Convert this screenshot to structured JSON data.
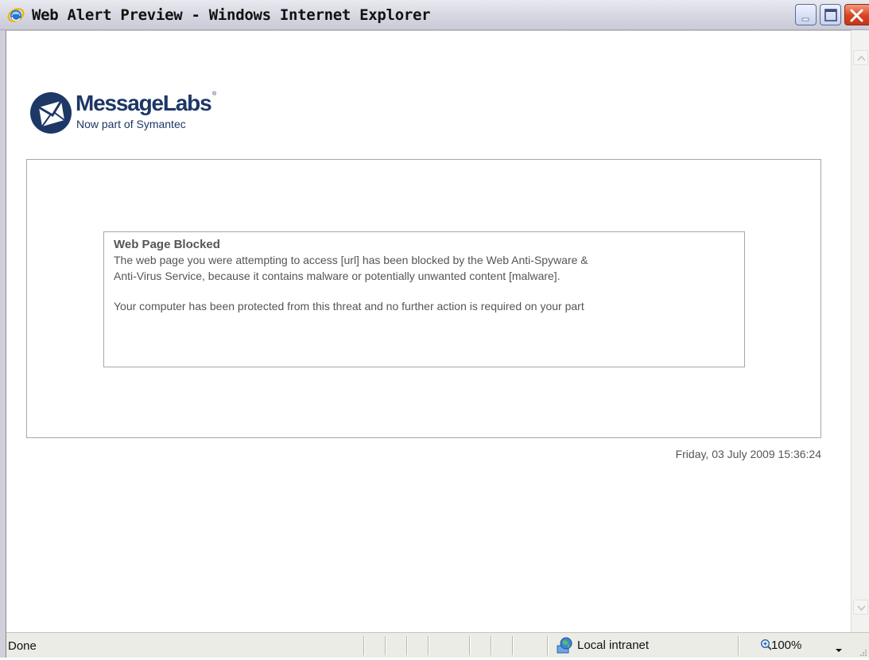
{
  "window": {
    "title": "Web Alert Preview - Windows Internet Explorer",
    "icon": "internet-explorer-icon",
    "controls": [
      "minimize-icon",
      "maximize-icon",
      "close-icon"
    ]
  },
  "logo": {
    "brand": "MessageLabs",
    "trademark": "®",
    "tagline": "Now part of Symantec",
    "icon": "messagelabs-envelope-logo"
  },
  "alert": {
    "title": "Web Page Blocked",
    "line1": "The web page you were attempting to access [url] has been blocked by the Web Anti-Spyware &",
    "line2": "Anti-Virus Service, because it contains malware or potentially unwanted content [malware].",
    "line3": "Your computer has been protected from this threat and no further action is required on your part"
  },
  "timestamp": "Friday, 03 July 2009 15:36:24",
  "statusbar": {
    "status": "Done",
    "zone_icon": "local-intranet-globe-icon",
    "zone": "Local intranet",
    "zoom_icon": "zoom-magnifier-icon",
    "zoom": "100%"
  },
  "colors": {
    "brand": "#1d3766",
    "text": "#555555",
    "border": "#a7a7a7"
  }
}
